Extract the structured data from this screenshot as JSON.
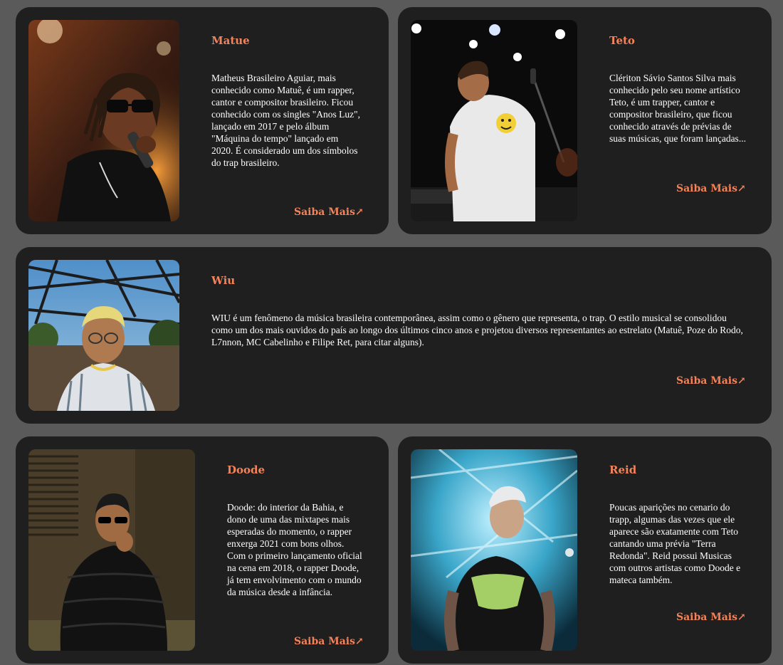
{
  "cards": [
    {
      "name": "Matue",
      "description": "Matheus Brasileiro Aguiar, mais conhecido como Matuê, é um rapper, cantor e compositor brasileiro. Ficou conhecido com os singles \"Anos Luz\", lançado em 2017 e pelo álbum \"Máquina do tempo\" lançado em 2020. É considerado um dos símbolos do trap brasileiro.",
      "link": "Saiba Mais↗"
    },
    {
      "name": "Teto",
      "description": "Clériton Sávio Santos Silva mais conhecido pelo seu nome artístico Teto, é um trapper, cantor e compositor brasileiro, que ficou conhecido através de prévias de suas músicas, que foram lançadas...",
      "link": "Saiba Mais↗"
    },
    {
      "name": "Wiu",
      "description": "WIU é um fenômeno da música brasileira contemporânea, assim como o gênero que representa, o trap. O estilo musical se consolidou como um dos mais ouvidos do país ao longo dos últimos cinco anos e projetou diversos representantes ao estrelato (Matuê, Poze do Rodo, L7nnon, MC Cabelinho e Filipe Ret, para citar alguns).",
      "link": "Saiba Mais↗"
    },
    {
      "name": "Doode",
      "description": "Doode: do interior da Bahia, e dono de uma das mixtapes mais esperadas do momento, o rapper enxerga 2021 com bons olhos. Com o primeiro lançamento oficial na cena em 2018, o rapper Doode, já tem envolvimento com o mundo da música desde a infância.",
      "link": "Saiba Mais↗"
    },
    {
      "name": "Reid",
      "description": "Poucas aparições no cenario do trapp, algumas das vezes que ele aparece são exatamente com Teto cantando uma prévia \"Terra Redonda\". Reid possui Musicas com outros artistas como Doode e mateca também.",
      "link": "Saiba Mais↗"
    }
  ],
  "colors": {
    "page_bg": "#5a5a5a",
    "card_bg": "#1f1f1f",
    "accent": "#f4835a",
    "text": "#ffffff"
  }
}
